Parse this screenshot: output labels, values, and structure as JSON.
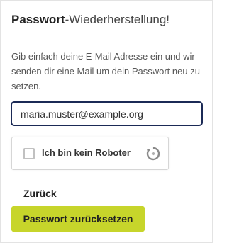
{
  "header": {
    "title_strong": "Passwort",
    "title_rest": "-Wiederherstellung!"
  },
  "intro": {
    "text": "Gib einfach deine E-Mail Adresse ein und wir senden dir eine Mail um dein Passwort neu zu setzen."
  },
  "form": {
    "email_value": "maria.muster@example.org"
  },
  "captcha": {
    "label": "Ich bin kein Roboter",
    "logo_icon": "recaptcha-icon"
  },
  "actions": {
    "back_label": "Zurück",
    "reset_label": "Passwort zurücksetzen"
  },
  "colors": {
    "accent": "#c7d52b",
    "input_border": "#1b2a56"
  }
}
